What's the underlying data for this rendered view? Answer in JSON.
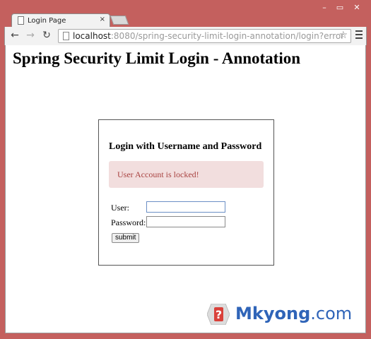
{
  "browser": {
    "tab_title": "Login Page",
    "tab_close": "×",
    "url_host": "localhost",
    "url_path": ":8080/spring-security-limit-login-annotation/login?error",
    "window_controls": {
      "minimize": "–",
      "maximize": "▭",
      "close": "✕"
    },
    "nav": {
      "back": "←",
      "forward": "→",
      "reload": "↻"
    },
    "star": "☆"
  },
  "page": {
    "title": "Spring Security Limit Login - Annotation"
  },
  "login": {
    "heading": "Login with Username and Password",
    "error_message": "User Account is locked!",
    "user_label": "User:",
    "password_label": "Password:",
    "user_value": "",
    "password_value": "",
    "submit_label": "submit"
  },
  "watermark": {
    "brand": "Mkyong",
    "suffix": ".com",
    "logo_glyph": "?"
  },
  "colors": {
    "window_frame": "#c4605e",
    "alert_bg": "#f2dede",
    "alert_text": "#a94442",
    "watermark_blue": "#2f64b8",
    "logo_red": "#d9403a"
  }
}
